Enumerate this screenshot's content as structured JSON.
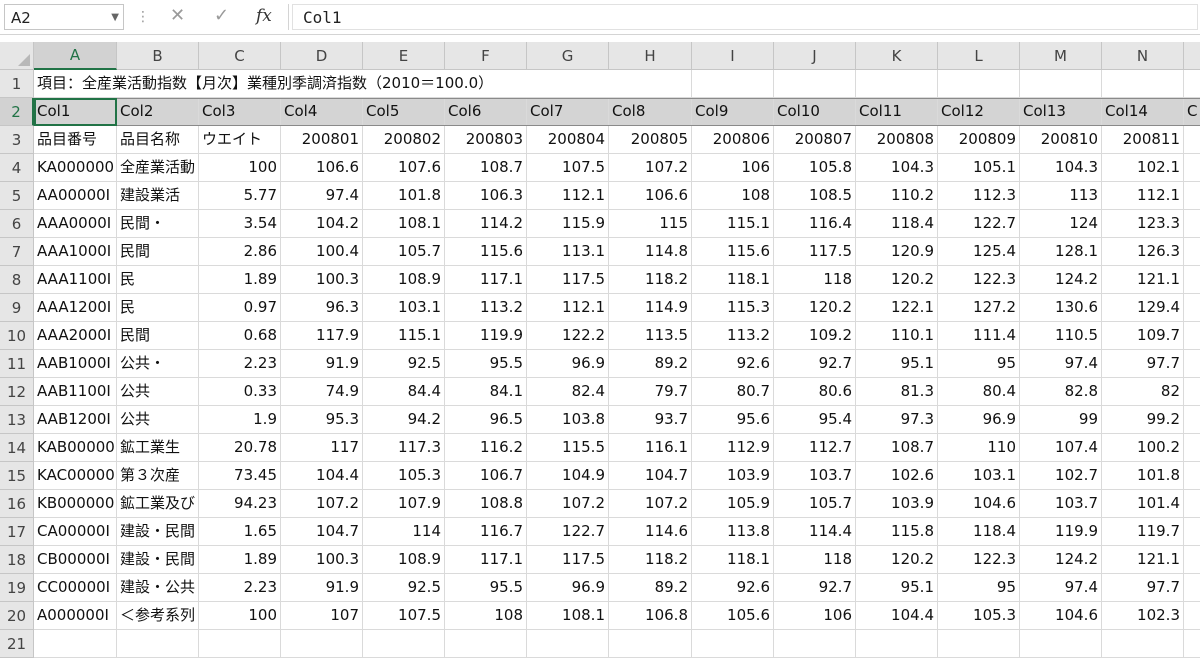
{
  "formula_bar": {
    "name_box": "A2",
    "cancel_icon": "✕",
    "enter_icon": "✓",
    "fx_label": "fx",
    "content": "Col1"
  },
  "columns": [
    "A",
    "B",
    "C",
    "D",
    "E",
    "F",
    "G",
    "H",
    "I",
    "J",
    "K",
    "L",
    "M",
    "N"
  ],
  "active_column": "A",
  "active_row": 2,
  "rows": [
    {
      "n": 1,
      "cells": [
        "項目：全産業活動指数【月次】業種別季調済指数（2010＝100.0）"
      ]
    },
    {
      "n": 2,
      "cells": [
        "Col1",
        "Col2",
        "Col3",
        "Col4",
        "Col5",
        "Col6",
        "Col7",
        "Col8",
        "Col9",
        "Col10",
        "Col11",
        "Col12",
        "Col13",
        "Col14",
        "C"
      ]
    },
    {
      "n": 3,
      "cells": [
        "品目番号",
        "品目名称",
        "ウエイト",
        "200801",
        "200802",
        "200803",
        "200804",
        "200805",
        "200806",
        "200807",
        "200808",
        "200809",
        "200810",
        "200811"
      ]
    },
    {
      "n": 4,
      "cells": [
        "KA000000",
        "全産業活動",
        "100",
        "106.6",
        "107.6",
        "108.7",
        "107.5",
        "107.2",
        "106",
        "105.8",
        "104.3",
        "105.1",
        "104.3",
        "102.1"
      ]
    },
    {
      "n": 5,
      "cells": [
        "AA00000I",
        "建設業活",
        "5.77",
        "97.4",
        "101.8",
        "106.3",
        "112.1",
        "106.6",
        "108",
        "108.5",
        "110.2",
        "112.3",
        "113",
        "112.1"
      ]
    },
    {
      "n": 6,
      "cells": [
        "AAA0000I",
        "民間・",
        "3.54",
        "104.2",
        "108.1",
        "114.2",
        "115.9",
        "115",
        "115.1",
        "116.4",
        "118.4",
        "122.7",
        "124",
        "123.3"
      ]
    },
    {
      "n": 7,
      "cells": [
        "AAA1000I",
        "民間",
        "2.86",
        "100.4",
        "105.7",
        "115.6",
        "113.1",
        "114.8",
        "115.6",
        "117.5",
        "120.9",
        "125.4",
        "128.1",
        "126.3"
      ]
    },
    {
      "n": 8,
      "cells": [
        "AAA1100I",
        "民",
        "1.89",
        "100.3",
        "108.9",
        "117.1",
        "117.5",
        "118.2",
        "118.1",
        "118",
        "120.2",
        "122.3",
        "124.2",
        "121.1"
      ]
    },
    {
      "n": 9,
      "cells": [
        "AAA1200I",
        "民",
        "0.97",
        "96.3",
        "103.1",
        "113.2",
        "112.1",
        "114.9",
        "115.3",
        "120.2",
        "122.1",
        "127.2",
        "130.6",
        "129.4"
      ]
    },
    {
      "n": 10,
      "cells": [
        "AAA2000I",
        "民間",
        "0.68",
        "117.9",
        "115.1",
        "119.9",
        "122.2",
        "113.5",
        "113.2",
        "109.2",
        "110.1",
        "111.4",
        "110.5",
        "109.7"
      ]
    },
    {
      "n": 11,
      "cells": [
        "AAB1000I",
        "公共・",
        "2.23",
        "91.9",
        "92.5",
        "95.5",
        "96.9",
        "89.2",
        "92.6",
        "92.7",
        "95.1",
        "95",
        "97.4",
        "97.7"
      ]
    },
    {
      "n": 12,
      "cells": [
        "AAB1100I",
        "公共",
        "0.33",
        "74.9",
        "84.4",
        "84.1",
        "82.4",
        "79.7",
        "80.7",
        "80.6",
        "81.3",
        "80.4",
        "82.8",
        "82"
      ]
    },
    {
      "n": 13,
      "cells": [
        "AAB1200I",
        "公共",
        "1.9",
        "95.3",
        "94.2",
        "96.5",
        "103.8",
        "93.7",
        "95.6",
        "95.4",
        "97.3",
        "96.9",
        "99",
        "99.2"
      ]
    },
    {
      "n": 14,
      "cells": [
        "KAB00000",
        "鉱工業生",
        "20.78",
        "117",
        "117.3",
        "116.2",
        "115.5",
        "116.1",
        "112.9",
        "112.7",
        "108.7",
        "110",
        "107.4",
        "100.2"
      ]
    },
    {
      "n": 15,
      "cells": [
        "KAC00000",
        "第３次産",
        "73.45",
        "104.4",
        "105.3",
        "106.7",
        "104.9",
        "104.7",
        "103.9",
        "103.7",
        "102.6",
        "103.1",
        "102.7",
        "101.8"
      ]
    },
    {
      "n": 16,
      "cells": [
        "KB000000",
        "鉱工業及び",
        "94.23",
        "107.2",
        "107.9",
        "108.8",
        "107.2",
        "107.2",
        "105.9",
        "105.7",
        "103.9",
        "104.6",
        "103.7",
        "101.4"
      ]
    },
    {
      "n": 17,
      "cells": [
        "CA00000I",
        "建設・民間",
        "1.65",
        "104.7",
        "114",
        "116.7",
        "122.7",
        "114.6",
        "113.8",
        "114.4",
        "115.8",
        "118.4",
        "119.9",
        "119.7"
      ]
    },
    {
      "n": 18,
      "cells": [
        "CB00000I",
        "建設・民間",
        "1.89",
        "100.3",
        "108.9",
        "117.1",
        "117.5",
        "118.2",
        "118.1",
        "118",
        "120.2",
        "122.3",
        "124.2",
        "121.1"
      ]
    },
    {
      "n": 19,
      "cells": [
        "CC00000I",
        "建設・公共",
        "2.23",
        "91.9",
        "92.5",
        "95.5",
        "96.9",
        "89.2",
        "92.6",
        "92.7",
        "95.1",
        "95",
        "97.4",
        "97.7"
      ]
    },
    {
      "n": 20,
      "cells": [
        "A000000I",
        "＜参考系列",
        "100",
        "107",
        "107.5",
        "108",
        "108.1",
        "106.8",
        "105.6",
        "106",
        "104.4",
        "105.3",
        "104.6",
        "102.3"
      ]
    },
    {
      "n": 21,
      "cells": []
    }
  ]
}
